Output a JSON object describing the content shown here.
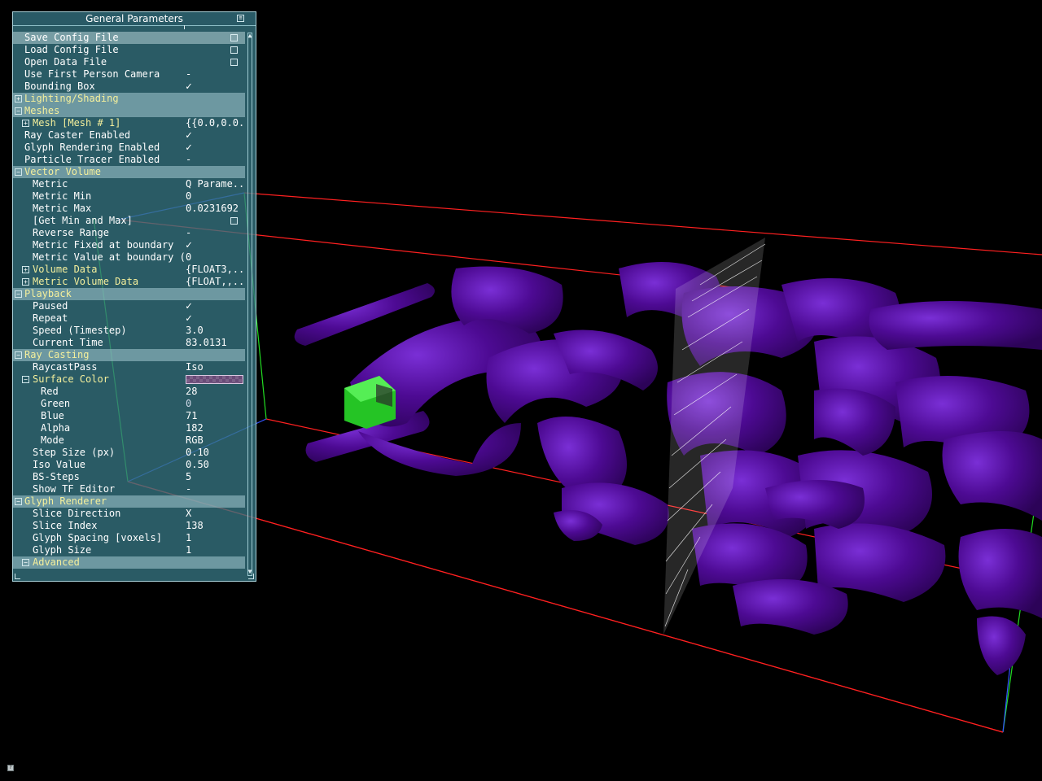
{
  "panel": {
    "title": "General Parameters",
    "min_icon": "minimize-icon",
    "rows": [
      {
        "id": "save-config",
        "label": "Save Config File",
        "type": "button",
        "indent": 0,
        "selected": true
      },
      {
        "id": "load-config",
        "label": "Load Config File",
        "type": "button",
        "indent": 0
      },
      {
        "id": "open-data",
        "label": "Open Data File",
        "type": "button",
        "indent": 0
      },
      {
        "id": "first-person",
        "label": "Use First Person Camera",
        "type": "value",
        "value": "-",
        "indent": 0
      },
      {
        "id": "bounding-box",
        "label": "Bounding Box",
        "type": "check",
        "value": "✓",
        "indent": 0
      },
      {
        "id": "lighting",
        "label": "Lighting/Shading",
        "type": "group",
        "expanded": false,
        "indent": 0
      },
      {
        "id": "meshes",
        "label": "Meshes",
        "type": "group",
        "expanded": true,
        "indent": 0
      },
      {
        "id": "mesh-1",
        "label": "Mesh [Mesh # 1]",
        "type": "subgroup",
        "expanded": false,
        "value": "{{0.0,0.0..",
        "indent": 1
      },
      {
        "id": "ray-caster-enabled",
        "label": "Ray Caster Enabled",
        "type": "check",
        "value": "✓",
        "indent": 0
      },
      {
        "id": "glyph-rendering-enabled",
        "label": "Glyph Rendering Enabled",
        "type": "check",
        "value": "✓",
        "indent": 0
      },
      {
        "id": "particle-tracer-enabled",
        "label": "Particle Tracer Enabled",
        "type": "value",
        "value": "-",
        "indent": 0
      },
      {
        "id": "vector-volume",
        "label": "Vector Volume",
        "type": "group",
        "expanded": true,
        "indent": 0
      },
      {
        "id": "metric",
        "label": "Metric",
        "type": "value",
        "value": "Q Parame..",
        "indent": 1
      },
      {
        "id": "metric-min",
        "label": "Metric Min",
        "type": "value",
        "value": "0",
        "indent": 1
      },
      {
        "id": "metric-max",
        "label": "Metric Max",
        "type": "value",
        "value": "0.0231692",
        "indent": 1
      },
      {
        "id": "get-min-max",
        "label": "[Get Min and Max]",
        "type": "button",
        "indent": 1
      },
      {
        "id": "reverse-range",
        "label": "Reverse Range",
        "type": "value",
        "value": "-",
        "indent": 1
      },
      {
        "id": "metric-fixed",
        "label": "Metric Fixed at boundary",
        "type": "check",
        "value": "✓",
        "indent": 1
      },
      {
        "id": "metric-value-boundary",
        "label": "Metric Value at boundary (if ..",
        "type": "value",
        "value": "0",
        "indent": 1
      },
      {
        "id": "volume-data",
        "label": "Volume Data",
        "type": "subgroup",
        "expanded": false,
        "value": "{FLOAT3,..",
        "indent": 1
      },
      {
        "id": "metric-volume-data",
        "label": "Metric Volume Data",
        "type": "subgroup",
        "expanded": false,
        "value": "{FLOAT,,...",
        "indent": 1
      },
      {
        "id": "playback",
        "label": "Playback",
        "type": "group",
        "expanded": true,
        "indent": 0
      },
      {
        "id": "paused",
        "label": "Paused",
        "type": "check",
        "value": "✓",
        "indent": 1
      },
      {
        "id": "repeat",
        "label": "Repeat",
        "type": "check",
        "value": "✓",
        "indent": 1
      },
      {
        "id": "speed",
        "label": "Speed (Timestep)",
        "type": "value",
        "value": "3.0",
        "indent": 1
      },
      {
        "id": "current-time",
        "label": "Current Time",
        "type": "value",
        "value": "83.0131",
        "indent": 1
      },
      {
        "id": "ray-casting",
        "label": "Ray Casting",
        "type": "group",
        "expanded": true,
        "indent": 0
      },
      {
        "id": "raycast-pass",
        "label": "RaycastPass",
        "type": "value",
        "value": "Iso",
        "indent": 1
      },
      {
        "id": "surface-color",
        "label": "Surface Color",
        "type": "subgroup",
        "expanded": true,
        "swatch": true,
        "indent": 1
      },
      {
        "id": "red",
        "label": "Red",
        "type": "value",
        "value": "28",
        "indent": 2
      },
      {
        "id": "green",
        "label": "Green",
        "type": "value",
        "value": "0",
        "dim": true,
        "indent": 2
      },
      {
        "id": "blue",
        "label": "Blue",
        "type": "value",
        "value": "71",
        "indent": 2
      },
      {
        "id": "alpha",
        "label": "Alpha",
        "type": "value",
        "value": "182",
        "indent": 2
      },
      {
        "id": "mode",
        "label": "Mode",
        "type": "value",
        "value": "RGB",
        "indent": 2
      },
      {
        "id": "step-size",
        "label": "Step Size (px)",
        "type": "value",
        "value": "0.10",
        "indent": 1
      },
      {
        "id": "iso-value",
        "label": "Iso Value",
        "type": "value",
        "value": "0.50",
        "indent": 1
      },
      {
        "id": "bs-steps",
        "label": "BS-Steps",
        "type": "value",
        "value": "5",
        "indent": 1
      },
      {
        "id": "show-tf-editor",
        "label": "Show TF Editor",
        "type": "value",
        "value": "-",
        "indent": 1
      },
      {
        "id": "glyph-renderer",
        "label": "Glyph Renderer",
        "type": "group",
        "expanded": true,
        "indent": 0
      },
      {
        "id": "slice-direction",
        "label": "Slice Direction",
        "type": "value",
        "value": "X",
        "indent": 1
      },
      {
        "id": "slice-index",
        "label": "Slice Index",
        "type": "value",
        "value": "138",
        "indent": 1
      },
      {
        "id": "glyph-spacing",
        "label": "Glyph Spacing [voxels]",
        "type": "value",
        "value": "1",
        "indent": 1
      },
      {
        "id": "glyph-size",
        "label": "Glyph Size",
        "type": "value",
        "value": "1",
        "indent": 1
      },
      {
        "id": "advanced",
        "label": "Advanced",
        "type": "group",
        "expanded": true,
        "indent": 1
      }
    ]
  },
  "scene": {
    "isosurface_color": "#4b0b8a",
    "bounding_box_color": "#ff1a1a",
    "highlight_cube_color": "#22cc22",
    "glyph_color": "#ffffff"
  }
}
